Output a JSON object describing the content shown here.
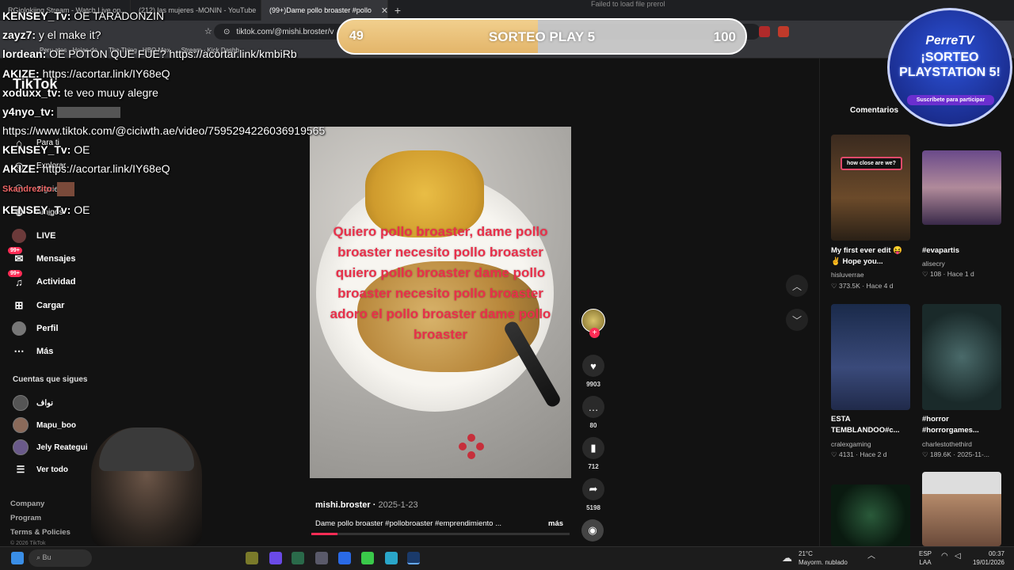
{
  "browser": {
    "tabs": [
      {
        "label": "RGiolokiing Stream - Watch Live on..."
      },
      {
        "label": "(212) las mujeres -MONIN - YouTube"
      },
      {
        "label": "(99+)Dame pollo broaster #pollo",
        "active": true
      }
    ],
    "url": "tiktok.com/@mishi.broster/v",
    "bookmarks": [
      "Peru ates - Hojas de",
      "The Thing - HBO Max",
      "Stream - Kick Dashb"
    ],
    "error_text": "Failed to load file  prerol"
  },
  "tiktok": {
    "logo": "TikTok",
    "nav": [
      {
        "label": "Para ti",
        "icon": "home-icon"
      },
      {
        "label": "Explorar",
        "icon": "compass-icon"
      },
      {
        "label": "Siguiendo",
        "icon": "users-icon"
      },
      {
        "label": "Amigos",
        "icon": "friends-icon"
      },
      {
        "label": "LIVE",
        "icon": "live-icon"
      },
      {
        "label": "Mensajes",
        "icon": "message-icon",
        "badge": "99+"
      },
      {
        "label": "Actividad",
        "icon": "bell-icon",
        "badge": "99+"
      },
      {
        "label": "Cargar",
        "icon": "plus-square-icon"
      },
      {
        "label": "Perfil",
        "icon": "profile-icon"
      },
      {
        "label": "Más",
        "icon": "more-icon"
      }
    ],
    "following_header": "Cuentas que sigues",
    "following": [
      "نواف",
      "Mapu_boo",
      "Jely Reategui"
    ],
    "see_all": "Ver todo",
    "footer": [
      "Company",
      "Program",
      "Terms & Policies",
      "© 2026 TikTok"
    ],
    "video": {
      "overlay_text": "Quiero pollo broaster, dame pollo broaster necesito pollo broaster quiero pollo broaster dame pollo broaster necesito pollo broaster adoro el pollo broaster dame pollo broaster",
      "username": "mishi.broster",
      "date": "2025-1-23",
      "description": "Dame pollo broaster #pollobroaster #emprendimiento ...",
      "more": "más",
      "progress": 0.1,
      "likes": "9903",
      "comments": "80",
      "saves": "712",
      "shares": "5198"
    },
    "comments_tab": "Comentarios",
    "related": [
      {
        "caption": "My first ever edit 😝✌ Hope you...",
        "user": "hisluverrae",
        "stats": "♡ 373.5K · Hace 4 d",
        "overlay": "how close are we?"
      },
      {
        "caption": "#evapartis",
        "user": "alisecry",
        "stats": "♡ 108 · Hace 1 d"
      },
      {
        "caption": "ESTA TEMBLANDOO#c...",
        "user": "cralexgaming",
        "stats": "♡ 4131 · Hace 2 d"
      },
      {
        "caption": "#horror #horrorgames...",
        "user": "charlestothethird",
        "stats": "♡ 189.6K · 2025-11-..."
      },
      {
        "caption": "",
        "user": "",
        "stats": ""
      },
      {
        "caption": "",
        "user": "",
        "stats": ""
      }
    ]
  },
  "stream": {
    "chat": [
      {
        "user": "KENSEY_Tv:",
        "msg": "OE TARADONZIN"
      },
      {
        "user": "zayz7:",
        "msg": "y el make it?"
      },
      {
        "user": "lordean:",
        "msg": "OE POTON QUE FUE? https://acortar.link/kmbiRb"
      },
      {
        "user": "AKIZE:",
        "msg": "https://acortar.link/IY68eQ"
      },
      {
        "user": "xoduxx_tv:",
        "msg": "te veo muuy alegre"
      },
      {
        "user": "y4nyo_tv:",
        "msg": ""
      },
      {
        "user": "",
        "msg": "https://www.tiktok.com/@ciciwth.ae/video/7595294226036919565"
      },
      {
        "user": "KENSEY_Tv:",
        "msg": "OE"
      },
      {
        "user": "AKIZE:",
        "msg": "https://acortar.link/IY68eQ"
      },
      {
        "user": "Skandrezito:",
        "msg": ""
      },
      {
        "user": "KENSEY_Tv:",
        "msg": "OE"
      }
    ],
    "sorteo": {
      "label": "SORTEO PLAY 5",
      "current": "49",
      "goal": "100",
      "progress": 0.49
    },
    "badge": {
      "brand": "PerreTV",
      "title": "¡SORTEO PLAYSTATION 5!",
      "cta": "Suscríbete para participar"
    }
  },
  "taskbar": {
    "weather_temp": "21°C",
    "weather_desc": "Mayorm. nublado",
    "lang": "ESP",
    "lang2": "LAA",
    "time": "00:37",
    "date": "19/01/2026",
    "search": "Bu"
  },
  "colors": {
    "tiktok_red": "#fe2c55",
    "overlay_text": "#e8304a"
  }
}
